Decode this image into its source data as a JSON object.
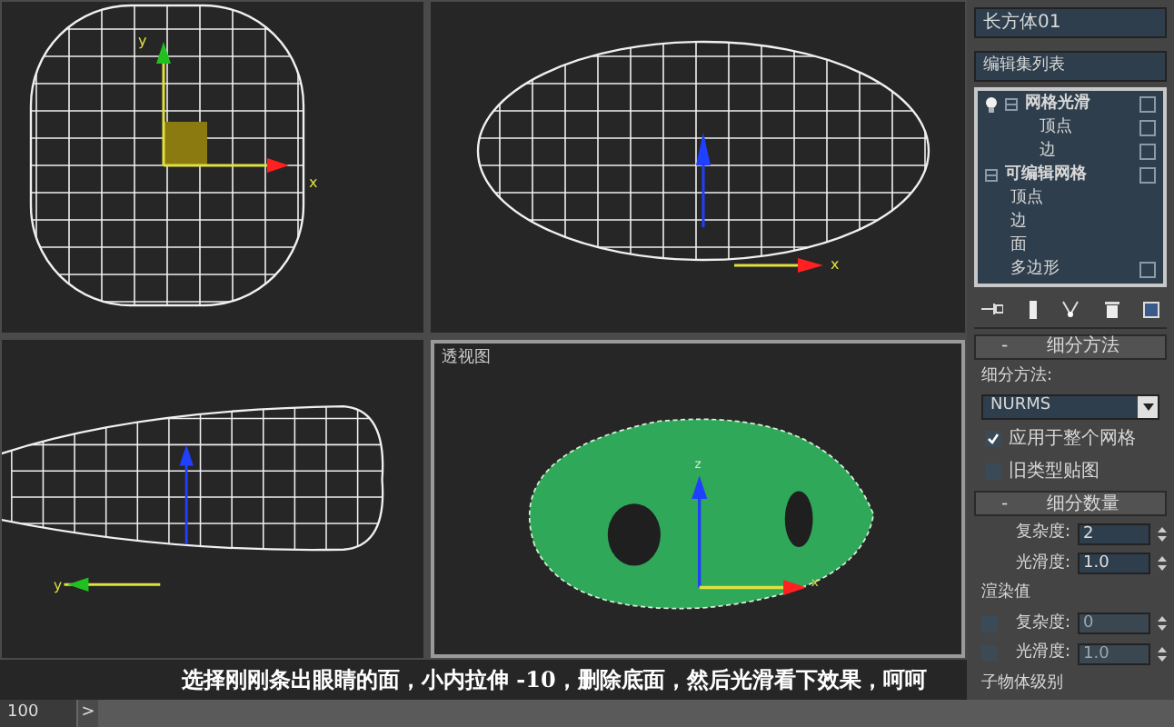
{
  "viewports": [
    {
      "kind": "front",
      "axes": [
        "y",
        "x"
      ]
    },
    {
      "kind": "top",
      "axes": [
        "x"
      ]
    },
    {
      "kind": "left",
      "axes": [
        "y"
      ]
    },
    {
      "kind": "perspective",
      "label": "透视图",
      "axes": [
        "z",
        "x"
      ]
    }
  ],
  "caption": "选择刚刚条出眼睛的面，小内拉伸 -10，删除底面，然后光滑看下效果，呵呵",
  "panel": {
    "object_name": "长方体01",
    "modifier_list": "编辑集列表",
    "stack": [
      {
        "label": "网格光滑",
        "checked": false,
        "children": [
          {
            "label": "顶点",
            "checked": false
          },
          {
            "label": "边",
            "checked": false
          }
        ]
      },
      {
        "label": "可编辑网格",
        "checked": false,
        "children": [
          {
            "label": "顶点"
          },
          {
            "label": "边"
          },
          {
            "label": "面"
          },
          {
            "label": "多边形",
            "checked": false
          }
        ]
      }
    ],
    "rollouts": [
      {
        "title": "细分方法",
        "sign": "-",
        "fields": [
          {
            "kind": "label",
            "label": "细分方法:"
          },
          {
            "kind": "dropdown",
            "value": "NURMS"
          },
          {
            "kind": "checkbox",
            "label": "应用于整个网格",
            "checked": true
          },
          {
            "kind": "checkbox",
            "label": "旧类型贴图",
            "checked": false
          }
        ]
      },
      {
        "title": "细分数量",
        "sign": "-",
        "fields": [
          {
            "kind": "spinner",
            "label": "复杂度:",
            "value": "2",
            "disabled": false
          },
          {
            "kind": "spinner",
            "label": "光滑度:",
            "value": "1.0",
            "disabled": false
          },
          {
            "kind": "label",
            "label": "渲染值"
          },
          {
            "kind": "check_spinner",
            "label": "复杂度:",
            "value": "0",
            "checked": false,
            "disabled": true
          },
          {
            "kind": "check_spinner",
            "label": "光滑度:",
            "value": "1.0",
            "checked": false,
            "disabled": true
          }
        ]
      }
    ],
    "section_hint": "子物体级别"
  },
  "status_bar": {
    "frame": "100",
    "next": ">"
  }
}
